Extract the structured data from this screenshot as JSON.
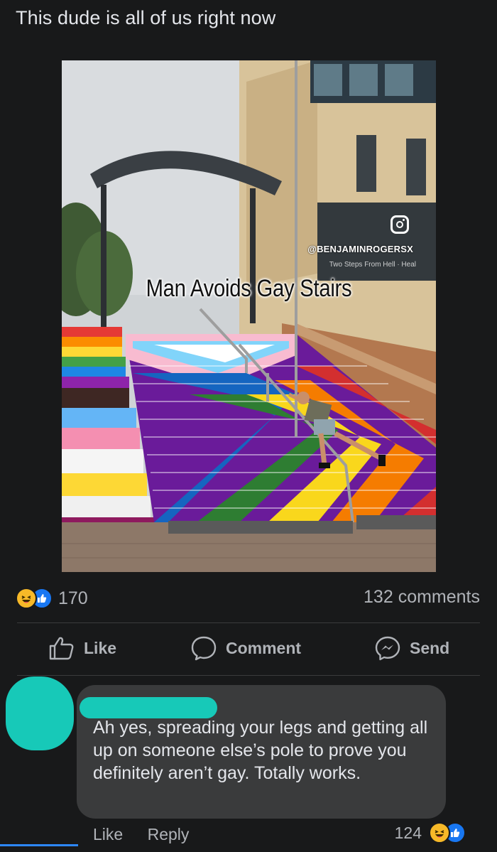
{
  "post": {
    "text": "This dude is all of us right now",
    "image": {
      "caption": "Man Avoids Gay Stairs",
      "watermark": "@BENJAMINROGERSX",
      "subtext": "Two Steps From Hell · Heal",
      "icon": "instagram-icon"
    }
  },
  "reactions": {
    "icons": [
      "haha-icon",
      "like-icon"
    ],
    "count": "170",
    "comments": "132 comments"
  },
  "actions": {
    "like": "Like",
    "comment": "Comment",
    "send": "Send"
  },
  "comment": {
    "text": "Ah yes, spreading your legs and getting all up on someone else’s pole to prove you definitely aren’t gay. Totally works.",
    "like": "Like",
    "reply": "Reply",
    "reaction_count": "124"
  },
  "colors": {
    "background": "#18191a",
    "bubble": "#3a3b3c",
    "accent": "#1877f2",
    "redaction": "#17c9b8"
  }
}
